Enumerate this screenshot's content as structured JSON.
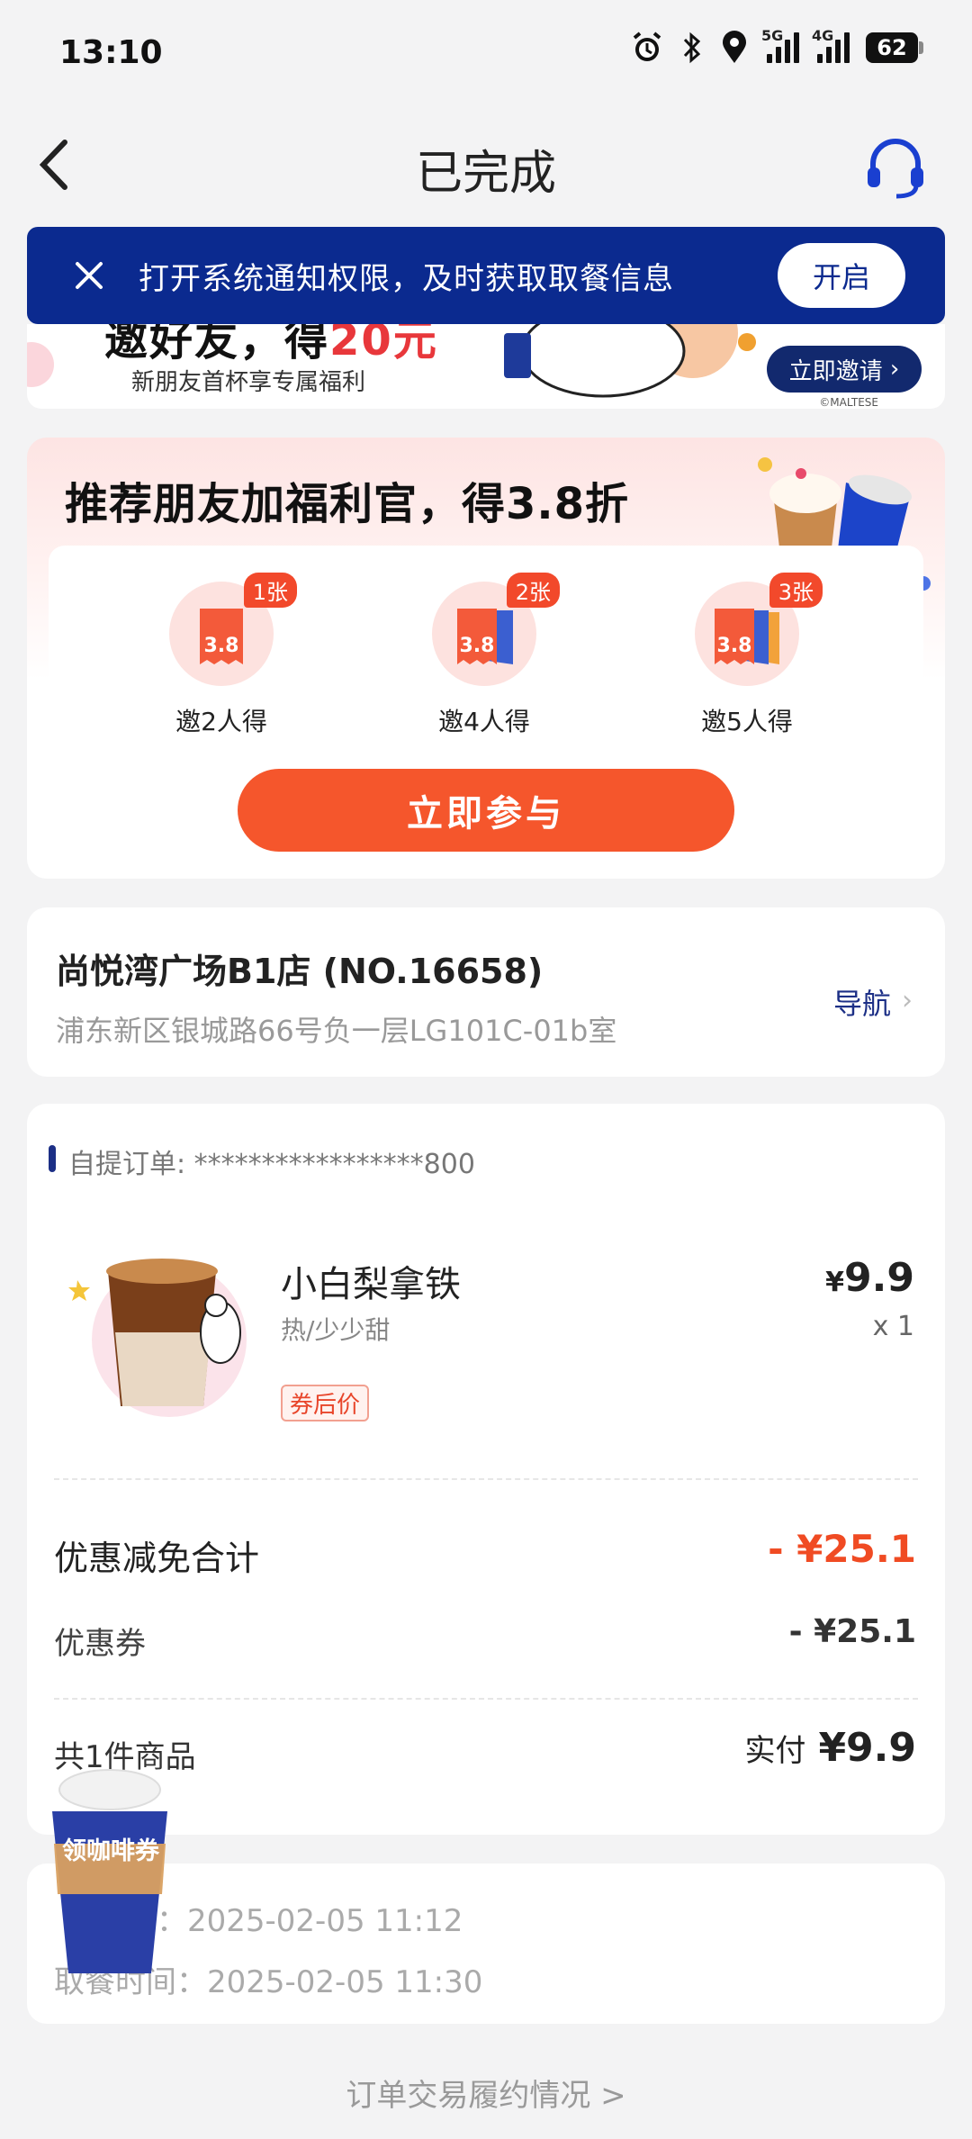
{
  "status_bar": {
    "time": "13:10",
    "net1": "5G",
    "net2": "4G",
    "battery": "62"
  },
  "nav": {
    "title": "已完成"
  },
  "notice": {
    "text": "打开系统通知权限，及时获取取餐信息",
    "button": "开启"
  },
  "invite_banner": {
    "headline_a": "邀好友，得",
    "headline_b": "20元",
    "sub": "新朋友首杯享专属福利",
    "button": "立即邀请",
    "copyright": "©MALTESE"
  },
  "referral": {
    "title": "推荐朋友加福利官，得3.8折",
    "tiers": [
      {
        "badge": "1张",
        "label": "邀2人得",
        "value": "3.8"
      },
      {
        "badge": "2张",
        "label": "邀4人得",
        "value": "3.8"
      },
      {
        "badge": "3张",
        "label": "邀5人得",
        "value": "3.8"
      }
    ],
    "button": "立即参与"
  },
  "store": {
    "name": "尚悦湾广场B1店 (NO.16658)",
    "address": "浦东新区银城路66号负一层LG101C-01b室",
    "nav_label": "导航"
  },
  "order": {
    "id_line": "自提订单: *****************800",
    "product_name": "小白梨拿铁",
    "spec": "热/少少甜",
    "tag": "券后价",
    "price_symbol": "¥",
    "price": "9.9",
    "qty": "x 1",
    "discount_label": "优惠减免合计",
    "discount_value": "- ¥25.1",
    "coupon_label": "优惠券",
    "coupon_value": "- ¥25.1",
    "count_label": "共1件商品",
    "paid_label": "实付",
    "paid_value": "¥9.9"
  },
  "times": {
    "order_time": "间：2025-02-05 11:12",
    "pickup_time": "取餐时间：2025-02-05 11:30"
  },
  "float_coupon": "领咖啡券",
  "footer_link": "订单交易履约情况 >"
}
